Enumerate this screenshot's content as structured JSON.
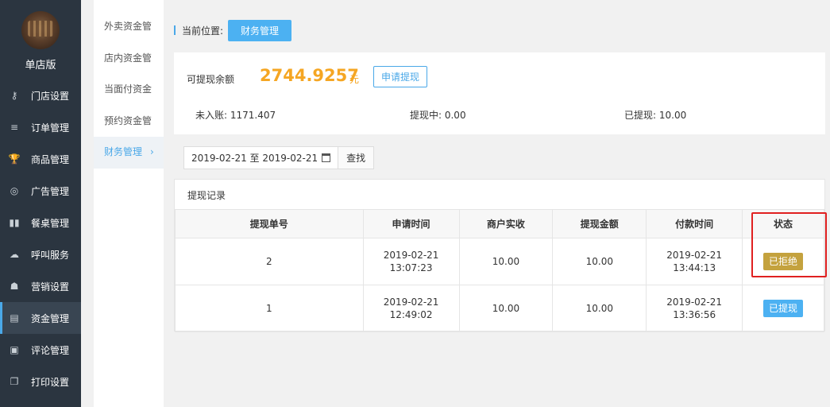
{
  "sidebar": {
    "shop_name": "单店版",
    "items": [
      {
        "label": "门店设置",
        "icon": "key-icon"
      },
      {
        "label": "订单管理",
        "icon": "list-icon"
      },
      {
        "label": "商品管理",
        "icon": "trophy-icon"
      },
      {
        "label": "广告管理",
        "icon": "lifebuoy-icon"
      },
      {
        "label": "餐桌管理",
        "icon": "binoculars-icon"
      },
      {
        "label": "呼叫服务",
        "icon": "cloud-icon"
      },
      {
        "label": "营销设置",
        "icon": "gift-icon"
      },
      {
        "label": "资金管理",
        "icon": "book-icon"
      },
      {
        "label": "评论管理",
        "icon": "money-icon"
      },
      {
        "label": "打印设置",
        "icon": "copy-icon"
      }
    ]
  },
  "submenu": {
    "items": [
      "外卖资金管",
      "店内资金管",
      "当面付资金",
      "预约资金管",
      "财务管理"
    ]
  },
  "breadcrumb": {
    "label": "当前位置:",
    "current": "财务管理"
  },
  "balance": {
    "label": "可提现余额",
    "amount": "2744.9257",
    "unit": "元",
    "apply_label": "申请提现",
    "unsettled": "未入账: 1171.407",
    "withdrawing": "提现中: 0.00",
    "withdrawn": "已提现: 10.00"
  },
  "filter": {
    "date_range": "2019-02-21 至 2019-02-21",
    "search_label": "查找"
  },
  "records": {
    "title": "提现记录",
    "columns": [
      "提现单号",
      "申请时间",
      "商户实收",
      "提现金额",
      "付款时间",
      "状态"
    ],
    "rows": [
      {
        "id": "2",
        "apply_date": "2019-02-21",
        "apply_time": "13:07:23",
        "received": "10.00",
        "amount": "10.00",
        "pay_date": "2019-02-21",
        "pay_time": "13:44:13",
        "status": "已拒绝"
      },
      {
        "id": "1",
        "apply_date": "2019-02-21",
        "apply_time": "12:49:02",
        "received": "10.00",
        "amount": "10.00",
        "pay_date": "2019-02-21",
        "pay_time": "13:36:56",
        "status": "已提现"
      }
    ]
  },
  "colors": {
    "accent": "#4cb1f2",
    "amount": "#f5a623",
    "rejected": "#c4a23e",
    "sidebar": "#2b3540",
    "highlight": "#e02020"
  }
}
